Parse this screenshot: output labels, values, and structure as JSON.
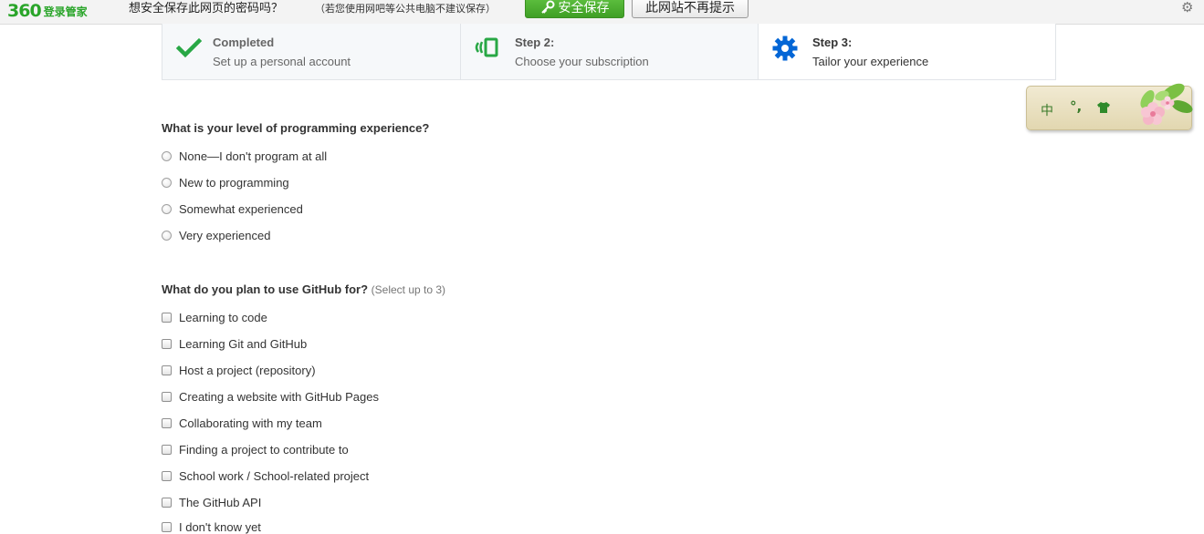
{
  "password_bar": {
    "brand_number": "360",
    "brand_name": "登录管家",
    "prompt": "想安全保存此网页的密码吗？",
    "note": "（若您使用网吧等公共电脑不建议保存）",
    "save_button": "安全保存",
    "never_button": "此网站不再提示",
    "icons": [
      "key-icon",
      "gear-icon"
    ]
  },
  "steps": [
    {
      "title": "Completed",
      "desc": "Set up a personal account",
      "icon": "check-icon",
      "color": "#28a745"
    },
    {
      "title": "Step 2:",
      "desc": "Choose your subscription",
      "icon": "subscription-icon",
      "color": "#28a745"
    },
    {
      "title": "Step 3:",
      "desc": "Tailor your experience",
      "icon": "gear-icon",
      "color": "#0366d6"
    }
  ],
  "experience": {
    "question": "What is your level of programming experience?",
    "options": [
      "None—I don't program at all",
      "New to programming",
      "Somewhat experienced",
      "Very experienced"
    ]
  },
  "usage": {
    "question": "What do you plan to use GitHub for?",
    "hint": "(Select up to 3)",
    "options": [
      "Learning to code",
      "Learning Git and GitHub",
      "Host a project (repository)",
      "Creating a website with GitHub Pages",
      "Collaborating with my team",
      "Finding a project to contribute to",
      "School work / School-related project",
      "The GitHub API",
      "I don't know yet"
    ]
  },
  "ime": {
    "mode": "中",
    "punct": "°,",
    "icons": [
      "shirt-icon",
      "flower-icon"
    ]
  }
}
